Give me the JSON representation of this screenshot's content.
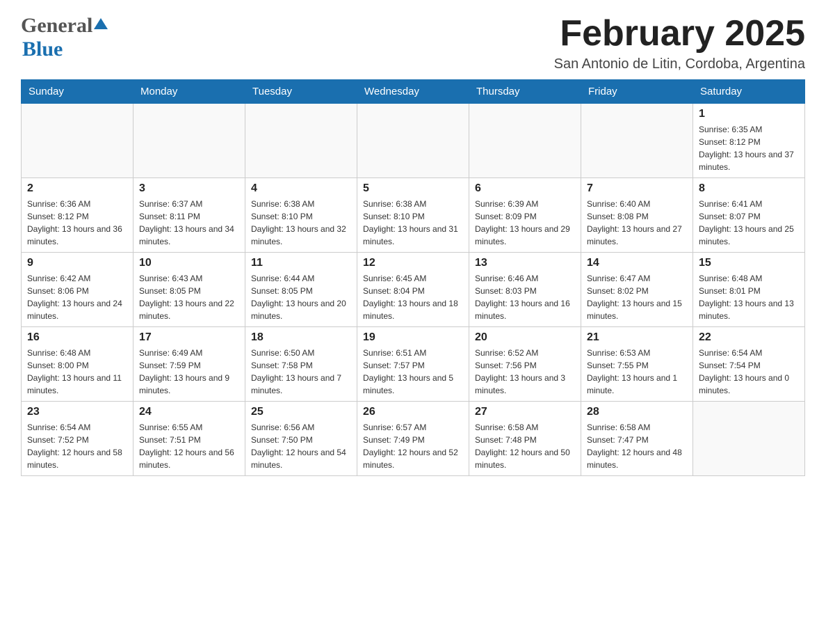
{
  "header": {
    "logo_general": "General",
    "logo_blue": "Blue",
    "month_title": "February 2025",
    "location": "San Antonio de Litin, Cordoba, Argentina"
  },
  "weekdays": [
    "Sunday",
    "Monday",
    "Tuesday",
    "Wednesday",
    "Thursday",
    "Friday",
    "Saturday"
  ],
  "weeks": [
    [
      {
        "day": "",
        "info": ""
      },
      {
        "day": "",
        "info": ""
      },
      {
        "day": "",
        "info": ""
      },
      {
        "day": "",
        "info": ""
      },
      {
        "day": "",
        "info": ""
      },
      {
        "day": "",
        "info": ""
      },
      {
        "day": "1",
        "info": "Sunrise: 6:35 AM\nSunset: 8:12 PM\nDaylight: 13 hours and 37 minutes."
      }
    ],
    [
      {
        "day": "2",
        "info": "Sunrise: 6:36 AM\nSunset: 8:12 PM\nDaylight: 13 hours and 36 minutes."
      },
      {
        "day": "3",
        "info": "Sunrise: 6:37 AM\nSunset: 8:11 PM\nDaylight: 13 hours and 34 minutes."
      },
      {
        "day": "4",
        "info": "Sunrise: 6:38 AM\nSunset: 8:10 PM\nDaylight: 13 hours and 32 minutes."
      },
      {
        "day": "5",
        "info": "Sunrise: 6:38 AM\nSunset: 8:10 PM\nDaylight: 13 hours and 31 minutes."
      },
      {
        "day": "6",
        "info": "Sunrise: 6:39 AM\nSunset: 8:09 PM\nDaylight: 13 hours and 29 minutes."
      },
      {
        "day": "7",
        "info": "Sunrise: 6:40 AM\nSunset: 8:08 PM\nDaylight: 13 hours and 27 minutes."
      },
      {
        "day": "8",
        "info": "Sunrise: 6:41 AM\nSunset: 8:07 PM\nDaylight: 13 hours and 25 minutes."
      }
    ],
    [
      {
        "day": "9",
        "info": "Sunrise: 6:42 AM\nSunset: 8:06 PM\nDaylight: 13 hours and 24 minutes."
      },
      {
        "day": "10",
        "info": "Sunrise: 6:43 AM\nSunset: 8:05 PM\nDaylight: 13 hours and 22 minutes."
      },
      {
        "day": "11",
        "info": "Sunrise: 6:44 AM\nSunset: 8:05 PM\nDaylight: 13 hours and 20 minutes."
      },
      {
        "day": "12",
        "info": "Sunrise: 6:45 AM\nSunset: 8:04 PM\nDaylight: 13 hours and 18 minutes."
      },
      {
        "day": "13",
        "info": "Sunrise: 6:46 AM\nSunset: 8:03 PM\nDaylight: 13 hours and 16 minutes."
      },
      {
        "day": "14",
        "info": "Sunrise: 6:47 AM\nSunset: 8:02 PM\nDaylight: 13 hours and 15 minutes."
      },
      {
        "day": "15",
        "info": "Sunrise: 6:48 AM\nSunset: 8:01 PM\nDaylight: 13 hours and 13 minutes."
      }
    ],
    [
      {
        "day": "16",
        "info": "Sunrise: 6:48 AM\nSunset: 8:00 PM\nDaylight: 13 hours and 11 minutes."
      },
      {
        "day": "17",
        "info": "Sunrise: 6:49 AM\nSunset: 7:59 PM\nDaylight: 13 hours and 9 minutes."
      },
      {
        "day": "18",
        "info": "Sunrise: 6:50 AM\nSunset: 7:58 PM\nDaylight: 13 hours and 7 minutes."
      },
      {
        "day": "19",
        "info": "Sunrise: 6:51 AM\nSunset: 7:57 PM\nDaylight: 13 hours and 5 minutes."
      },
      {
        "day": "20",
        "info": "Sunrise: 6:52 AM\nSunset: 7:56 PM\nDaylight: 13 hours and 3 minutes."
      },
      {
        "day": "21",
        "info": "Sunrise: 6:53 AM\nSunset: 7:55 PM\nDaylight: 13 hours and 1 minute."
      },
      {
        "day": "22",
        "info": "Sunrise: 6:54 AM\nSunset: 7:54 PM\nDaylight: 13 hours and 0 minutes."
      }
    ],
    [
      {
        "day": "23",
        "info": "Sunrise: 6:54 AM\nSunset: 7:52 PM\nDaylight: 12 hours and 58 minutes."
      },
      {
        "day": "24",
        "info": "Sunrise: 6:55 AM\nSunset: 7:51 PM\nDaylight: 12 hours and 56 minutes."
      },
      {
        "day": "25",
        "info": "Sunrise: 6:56 AM\nSunset: 7:50 PM\nDaylight: 12 hours and 54 minutes."
      },
      {
        "day": "26",
        "info": "Sunrise: 6:57 AM\nSunset: 7:49 PM\nDaylight: 12 hours and 52 minutes."
      },
      {
        "day": "27",
        "info": "Sunrise: 6:58 AM\nSunset: 7:48 PM\nDaylight: 12 hours and 50 minutes."
      },
      {
        "day": "28",
        "info": "Sunrise: 6:58 AM\nSunset: 7:47 PM\nDaylight: 12 hours and 48 minutes."
      },
      {
        "day": "",
        "info": ""
      }
    ]
  ]
}
